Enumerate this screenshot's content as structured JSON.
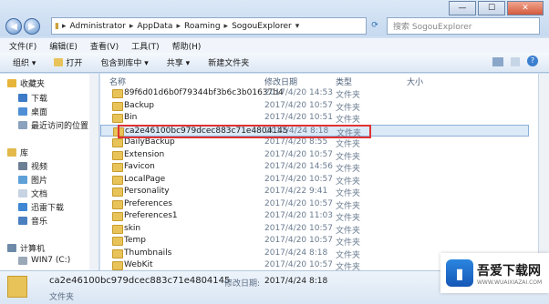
{
  "window": {
    "minimize": "—",
    "maximize": "☐",
    "close": "✕"
  },
  "address": {
    "crumbs": [
      "Administrator",
      "AppData",
      "Roaming",
      "SogouExplorer"
    ]
  },
  "search": {
    "placeholder": "搜索 SogouExplorer"
  },
  "menu": [
    "文件(F)",
    "编辑(E)",
    "查看(V)",
    "工具(T)",
    "帮助(H)"
  ],
  "toolbar": [
    "组织 ▾",
    "打开",
    "包含到库中 ▾",
    "共享 ▾",
    "新建文件夹"
  ],
  "nav": {
    "favorites": "收藏夹",
    "download": "下载",
    "desktop": "桌面",
    "recent": "最近访问的位置",
    "library": "库",
    "video": "视频",
    "pictures": "图片",
    "docs": "文档",
    "thunder": "迅雷下载",
    "music": "音乐",
    "computer": "计算机",
    "drive": "WIN7 (C:)"
  },
  "columns": {
    "name": "名称",
    "date": "修改日期",
    "type": "类型",
    "size": "大小"
  },
  "files": [
    {
      "name": "89f6d01d6b0f79344bf3b6c3b01637b4",
      "date": "2017/4/20 14:53",
      "type": "文件夹"
    },
    {
      "name": "Backup",
      "date": "2017/4/20 10:57",
      "type": "文件夹"
    },
    {
      "name": "Bin",
      "date": "2017/4/20 10:51",
      "type": "文件夹"
    },
    {
      "name": "ca2e46100bc979dcec883c71e4804145",
      "date": "2017/4/24 8:18",
      "type": "文件夹"
    },
    {
      "name": "DailyBackup",
      "date": "2017/4/20 8:55",
      "type": "文件夹"
    },
    {
      "name": "Extension",
      "date": "2017/4/20 10:57",
      "type": "文件夹"
    },
    {
      "name": "Favicon",
      "date": "2017/4/20 14:56",
      "type": "文件夹"
    },
    {
      "name": "LocalPage",
      "date": "2017/4/20 10:57",
      "type": "文件夹"
    },
    {
      "name": "Personality",
      "date": "2017/4/22 9:41",
      "type": "文件夹"
    },
    {
      "name": "Preferences",
      "date": "2017/4/20 10:57",
      "type": "文件夹"
    },
    {
      "name": "Preferences1",
      "date": "2017/4/20 11:03",
      "type": "文件夹"
    },
    {
      "name": "skin",
      "date": "2017/4/20 10:57",
      "type": "文件夹"
    },
    {
      "name": "Temp",
      "date": "2017/4/20 10:57",
      "type": "文件夹"
    },
    {
      "name": "Thumbnails",
      "date": "2017/4/24 8:18",
      "type": "文件夹"
    },
    {
      "name": "WebKit",
      "date": "2017/4/20 10:57",
      "type": "文件夹"
    }
  ],
  "status": {
    "name": "ca2e46100bc979dcec883c71e4804145",
    "date_label": "修改日期:",
    "date": "2017/4/24 8:18",
    "type": "文件夹"
  },
  "watermark": {
    "title": "吾爱下载网",
    "url": "WWW.WUAIXIAZAI.COM"
  }
}
